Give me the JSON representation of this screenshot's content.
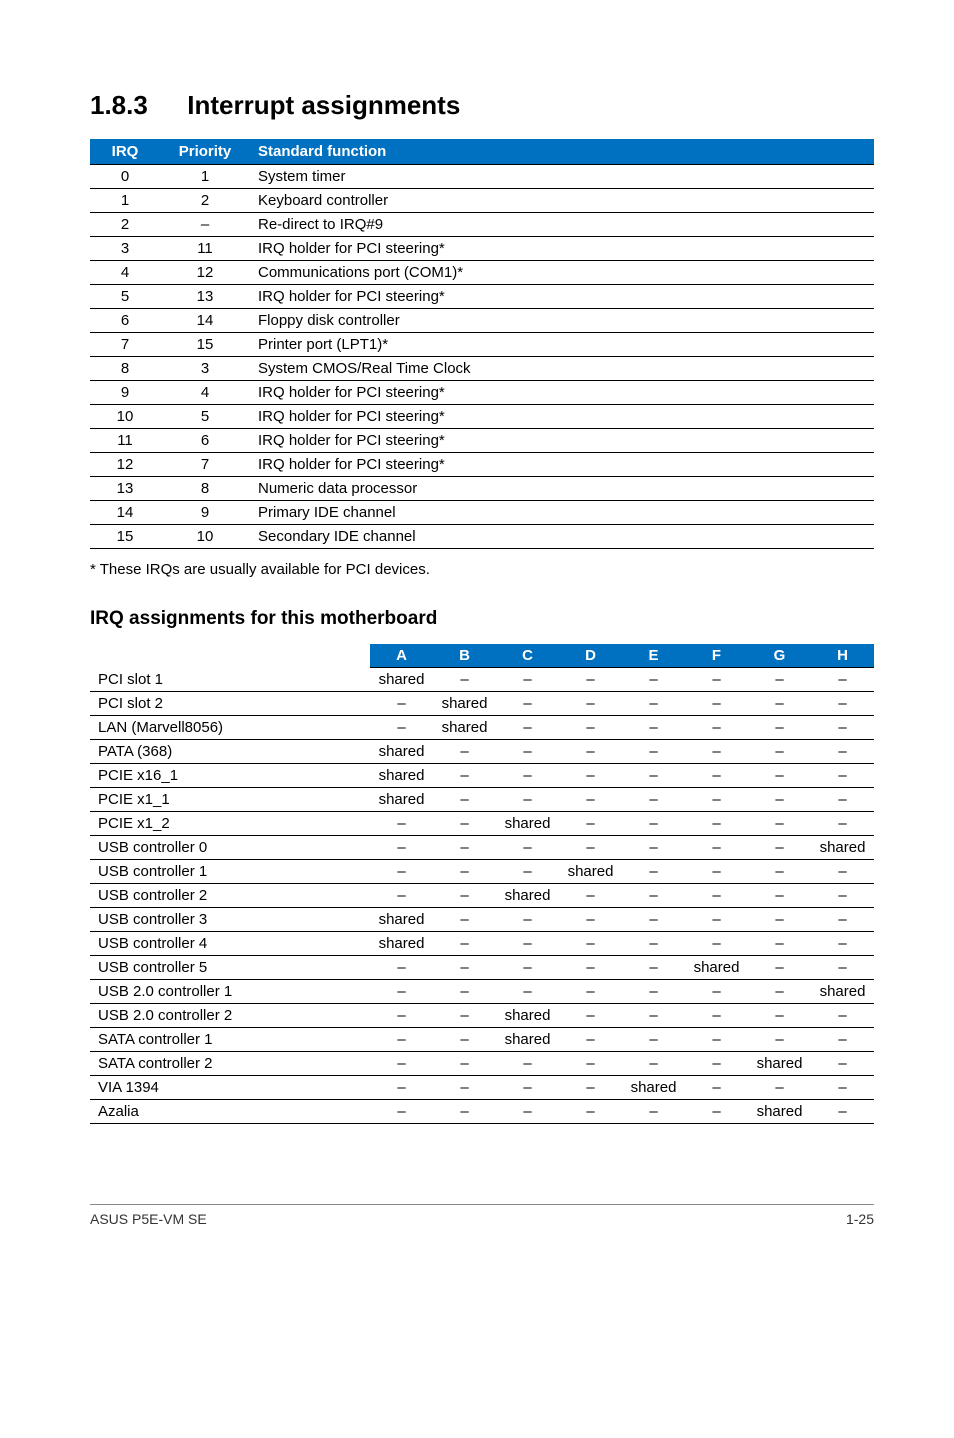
{
  "section": {
    "number": "1.8.3",
    "title": "Interrupt assignments"
  },
  "irq_table": {
    "headers": {
      "irq": "IRQ",
      "priority": "Priority",
      "func": "Standard function"
    },
    "rows": [
      {
        "irq": "0",
        "pri": "1",
        "func": "System timer"
      },
      {
        "irq": "1",
        "pri": "2",
        "func": "Keyboard controller"
      },
      {
        "irq": "2",
        "pri": "–",
        "func": "Re-direct to IRQ#9"
      },
      {
        "irq": "3",
        "pri": "11",
        "func": "IRQ holder for PCI steering*"
      },
      {
        "irq": "4",
        "pri": "12",
        "func": "Communications port (COM1)*"
      },
      {
        "irq": "5",
        "pri": "13",
        "func": "IRQ holder for PCI steering*"
      },
      {
        "irq": "6",
        "pri": "14",
        "func": "Floppy disk controller"
      },
      {
        "irq": "7",
        "pri": "15",
        "func": "Printer port (LPT1)*"
      },
      {
        "irq": "8",
        "pri": "3",
        "func": "System CMOS/Real Time Clock"
      },
      {
        "irq": "9",
        "pri": "4",
        "func": "IRQ holder for PCI steering*"
      },
      {
        "irq": "10",
        "pri": "5",
        "func": "IRQ holder for PCI steering*"
      },
      {
        "irq": "11",
        "pri": "6",
        "func": "IRQ holder for PCI steering*"
      },
      {
        "irq": "12",
        "pri": "7",
        "func": "IRQ holder for PCI steering*"
      },
      {
        "irq": "13",
        "pri": "8",
        "func": "Numeric data processor"
      },
      {
        "irq": "14",
        "pri": "9",
        "func": "Primary IDE channel"
      },
      {
        "irq": "15",
        "pri": "10",
        "func": "Secondary IDE channel"
      }
    ]
  },
  "footnote": "* These IRQs are usually available for PCI devices.",
  "sub_title": "IRQ assignments for this motherboard",
  "assign_table": {
    "headers": [
      "A",
      "B",
      "C",
      "D",
      "E",
      "F",
      "G",
      "H"
    ],
    "rows": [
      {
        "label": "PCI slot 1",
        "cells": [
          "shared",
          "–",
          "–",
          "–",
          "–",
          "–",
          "–",
          "–"
        ]
      },
      {
        "label": "PCI slot 2",
        "cells": [
          "–",
          "shared",
          "–",
          "–",
          "–",
          "–",
          "–",
          "–"
        ]
      },
      {
        "label": "LAN (Marvell8056)",
        "cells": [
          "–",
          "shared",
          "–",
          "–",
          "–",
          "–",
          "–",
          "–"
        ]
      },
      {
        "label": "PATA (368)",
        "cells": [
          "shared",
          "–",
          "–",
          "–",
          "–",
          "–",
          "–",
          "–"
        ]
      },
      {
        "label": "PCIE x16_1",
        "cells": [
          "shared",
          "–",
          "–",
          "–",
          "–",
          "–",
          "–",
          "–"
        ]
      },
      {
        "label": "PCIE x1_1",
        "cells": [
          "shared",
          "–",
          "–",
          "–",
          "–",
          "–",
          "–",
          "–"
        ]
      },
      {
        "label": "PCIE x1_2",
        "cells": [
          "–",
          "–",
          "shared",
          "–",
          "–",
          "–",
          "–",
          "–"
        ]
      },
      {
        "label": "USB controller 0",
        "cells": [
          "–",
          "–",
          "–",
          "–",
          "–",
          "–",
          "–",
          "shared"
        ]
      },
      {
        "label": "USB controller 1",
        "cells": [
          "–",
          "–",
          "–",
          "shared",
          "–",
          "–",
          "–",
          "–"
        ]
      },
      {
        "label": "USB controller 2",
        "cells": [
          "–",
          "–",
          "shared",
          "–",
          "–",
          "–",
          "–",
          "–"
        ]
      },
      {
        "label": "USB controller 3",
        "cells": [
          "shared",
          "–",
          "–",
          "–",
          "–",
          "–",
          "–",
          "–"
        ]
      },
      {
        "label": "USB controller 4",
        "cells": [
          "shared",
          "–",
          "–",
          "–",
          "–",
          "–",
          "–",
          "–"
        ]
      },
      {
        "label": "USB controller 5",
        "cells": [
          "–",
          "–",
          "–",
          "–",
          "–",
          "shared",
          "–",
          "–"
        ]
      },
      {
        "label": "USB 2.0 controller 1",
        "cells": [
          "–",
          "–",
          "–",
          "–",
          "–",
          "–",
          "–",
          "shared"
        ]
      },
      {
        "label": "USB 2.0 controller 2",
        "cells": [
          "–",
          "–",
          "shared",
          "–",
          "–",
          "–",
          "–",
          "–"
        ]
      },
      {
        "label": "SATA controller 1",
        "cells": [
          "–",
          "–",
          "shared",
          "–",
          "–",
          "–",
          "–",
          "–"
        ]
      },
      {
        "label": "SATA controller 2",
        "cells": [
          "–",
          "–",
          "–",
          "–",
          "–",
          "–",
          "shared",
          "–"
        ]
      },
      {
        "label": "VIA 1394",
        "cells": [
          "–",
          "–",
          "–",
          "–",
          "shared",
          "–",
          "–",
          "–"
        ]
      },
      {
        "label": "Azalia",
        "cells": [
          "–",
          "–",
          "–",
          "–",
          "–",
          "–",
          "shared",
          "–"
        ]
      }
    ]
  },
  "footer": {
    "left": "ASUS P5E-VM SE",
    "right": "1-25"
  }
}
